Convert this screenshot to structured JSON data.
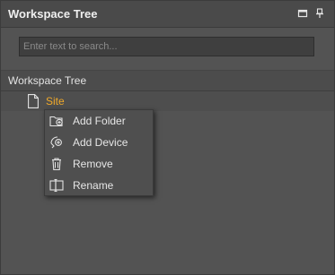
{
  "panel": {
    "title": "Workspace Tree",
    "buttons": [
      {
        "icon": "restore-icon"
      },
      {
        "icon": "pin-icon"
      }
    ]
  },
  "search": {
    "placeholder": "Enter text to search...",
    "value": ""
  },
  "tree": {
    "header": "Workspace Tree",
    "root": {
      "label": "Site",
      "icon": "file-icon",
      "label_color": "#f0a92a"
    }
  },
  "context_menu": {
    "items": [
      {
        "label": "Add Folder",
        "icon": "add-folder-icon"
      },
      {
        "label": "Add Device",
        "icon": "add-device-icon"
      },
      {
        "label": "Remove",
        "icon": "trash-icon"
      },
      {
        "label": "Rename",
        "icon": "rename-icon"
      }
    ]
  }
}
